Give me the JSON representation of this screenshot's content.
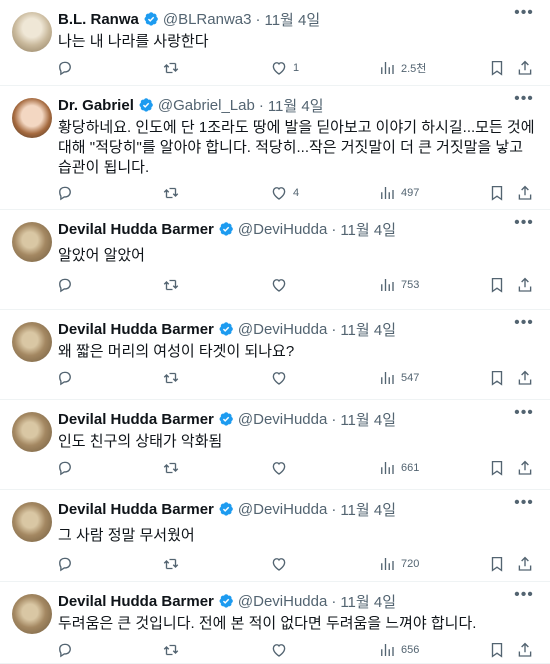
{
  "tweets": [
    {
      "name": "B.L. Ranwa",
      "handle": "@BLRanwa3",
      "date": "11월 4일",
      "text": "나는 내 나라를 사랑한다",
      "replies": "",
      "retweets": "",
      "likes": "1",
      "views": "2.5천",
      "avatar": "v1"
    },
    {
      "name": "Dr. Gabriel",
      "handle": "@Gabriel_Lab",
      "date": "11월 4일",
      "text": "황당하네요. 인도에 단 1조라도 땅에 발을 딛아보고 이야기 하시길...모든 것에 대해 \"적당히\"를 알아야 합니다. 적당히...작은 거짓말이 더 큰 거짓말을 낳고 습관이 됩니다.",
      "replies": "",
      "retweets": "",
      "likes": "4",
      "views": "497",
      "avatar": "v2"
    },
    {
      "name": "Devilal Hudda Barmer",
      "handle": "@DeviHudda",
      "date": "11월 4일",
      "text": "알았어 알았어",
      "replies": "",
      "retweets": "",
      "likes": "",
      "views": "753",
      "avatar": "v3"
    },
    {
      "name": "Devilal Hudda Barmer",
      "handle": "@DeviHudda",
      "date": "11월 4일",
      "text": "왜 짧은 머리의 여성이 타겟이 되나요?",
      "replies": "",
      "retweets": "",
      "likes": "",
      "views": "547",
      "avatar": "v3"
    },
    {
      "name": "Devilal Hudda Barmer",
      "handle": "@DeviHudda",
      "date": "11월 4일",
      "text": "인도 친구의 상태가 악화됨",
      "replies": "",
      "retweets": "",
      "likes": "",
      "views": "661",
      "avatar": "v3"
    },
    {
      "name": "Devilal Hudda Barmer",
      "handle": "@DeviHudda",
      "date": "11월 4일",
      "text": "그 사람 정말 무서웠어",
      "replies": "",
      "retweets": "",
      "likes": "",
      "views": "720",
      "avatar": "v3"
    },
    {
      "name": "Devilal Hudda Barmer",
      "handle": "@DeviHudda",
      "date": "11월 4일",
      "text": "두려움은 큰 것입니다. 전에 본 적이 없다면 두려움을 느껴야 합니다.",
      "replies": "",
      "retweets": "",
      "likes": "",
      "views": "656",
      "avatar": "v3"
    }
  ],
  "separator": "·",
  "icons": {
    "verified": "verified-badge-icon",
    "more": "more-icon",
    "reply": "reply-icon",
    "retweet": "retweet-icon",
    "like": "like-icon",
    "views": "views-icon",
    "bookmark": "bookmark-icon",
    "share": "share-icon"
  },
  "colors": {
    "verified": "#1d9bf0",
    "text": "#0f1419",
    "muted": "#536471",
    "border": "#eff3f4"
  }
}
